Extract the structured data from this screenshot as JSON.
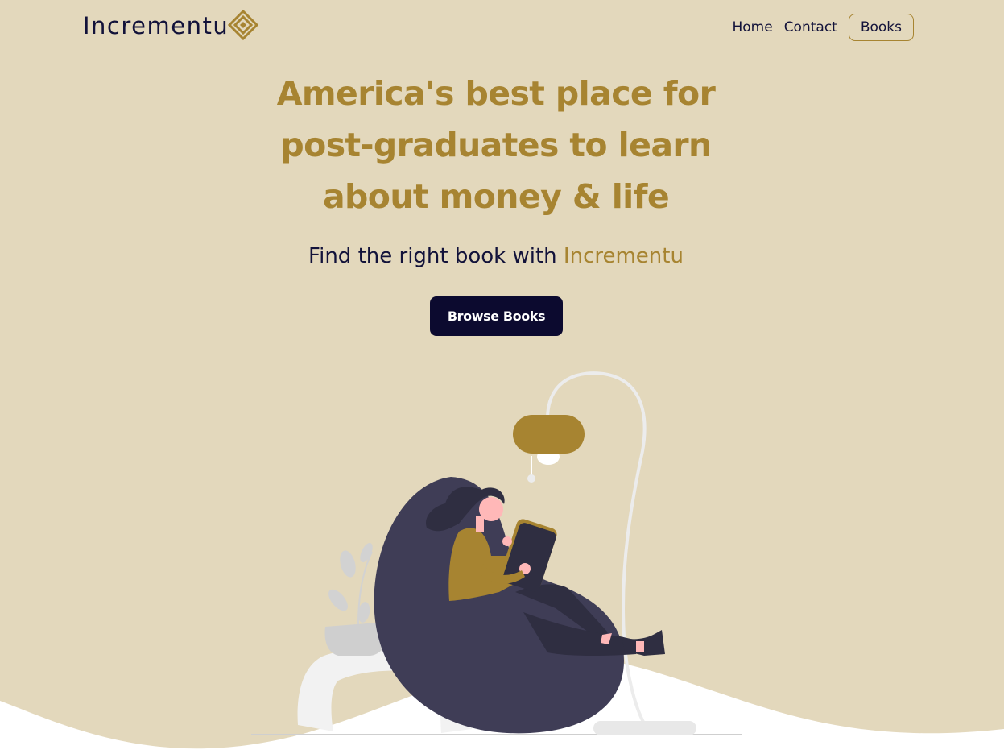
{
  "nav": {
    "brand": "Incrementu",
    "links": [
      "Home",
      "Contact"
    ],
    "books_button": "Books"
  },
  "hero": {
    "title_lines": [
      "America's best place for",
      "post-graduates to learn",
      "about money & life"
    ],
    "subtitle_prefix": "Find the right book with ",
    "subtitle_brand": "Incrementu",
    "cta_label": "Browse Books"
  },
  "colors": {
    "background": "#e3d8bc",
    "accent": "#a78431",
    "navy": "#0c0a2f",
    "wave": "#ffffff"
  },
  "icons": {
    "logo_mark": "nested-diamond-icon"
  }
}
